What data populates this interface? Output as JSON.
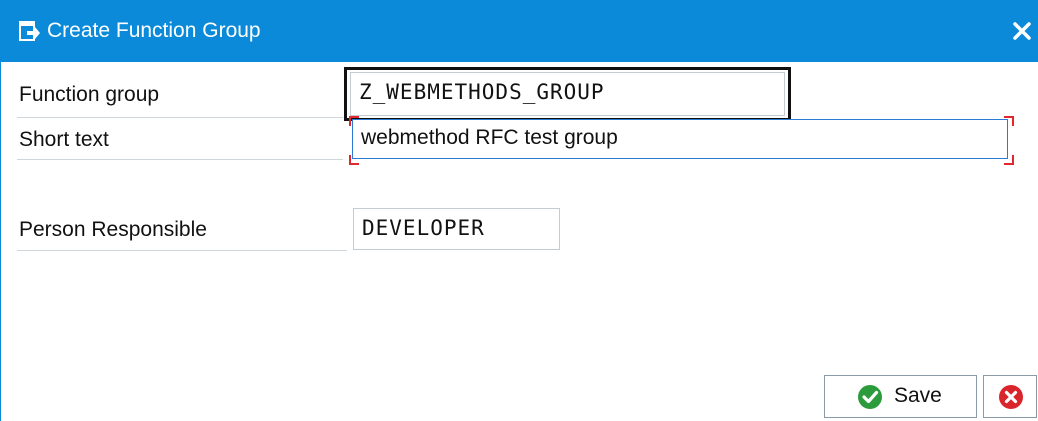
{
  "dialog": {
    "title": "Create Function Group",
    "title_icon": "create-document-icon",
    "close_icon": "close-icon"
  },
  "form": {
    "function_group": {
      "label": "Function group",
      "value": "Z_WEBMETHODS_GROUP"
    },
    "short_text": {
      "label": "Short text",
      "value": "webmethod RFC test group"
    },
    "person_responsible": {
      "label": "Person Responsible",
      "value": "DEVELOPER"
    }
  },
  "buttons": {
    "save_label": "Save",
    "save_icon": "checkmark-icon",
    "cancel_icon": "cancel-icon"
  },
  "colors": {
    "titlebar": "#0a8ad8",
    "focus_border": "#111111",
    "active_field_border": "#2a7bd4",
    "required_marker": "#e0282e",
    "save_icon": "#2b9b3c",
    "cancel_icon": "#d9262c"
  }
}
